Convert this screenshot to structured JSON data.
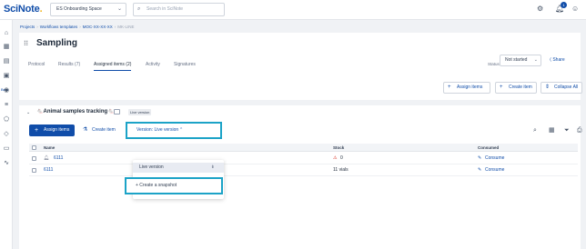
{
  "topbar": {
    "logo": "SciNote",
    "logo_dot": ".",
    "space": "ES Onboarding Space",
    "search_placeholder": "Search in SciNote",
    "notification_count": "1"
  },
  "sidebar": {
    "active_label": "Beta"
  },
  "breadcrumb": {
    "items": [
      "Projects",
      "Workflows templates",
      "MOC-XX-XX-XX"
    ],
    "current": "MK-LINE"
  },
  "page": {
    "title": "Sampling",
    "tabs": [
      "Protocol",
      "Results (7)",
      "Assigned items (2)",
      "Activity",
      "Signatures"
    ],
    "status_label": "Status",
    "status_value": "Not started",
    "share_label": "Share"
  },
  "toolbar": {
    "assign_items": "Assign items",
    "create_item": "Create item",
    "collapse_all": "Collapse All"
  },
  "repository": {
    "title": "Animal samples tracking",
    "emoji": "🐁",
    "badge": "Live version",
    "assign_items": "Assign items",
    "create_item": "Create item",
    "version_button": "Version: Live version"
  },
  "dropdown": {
    "live_version": "Live version",
    "create_snapshot": "+ Create a snapshot"
  },
  "table": {
    "headers": {
      "name": "Name",
      "stock": "Stock",
      "consumed": "Consumed"
    },
    "rows": [
      {
        "name": "6111",
        "stock": "0",
        "consumed": "Consume"
      },
      {
        "name": "6111",
        "stock": "11 vials",
        "consumed": "Consume"
      }
    ]
  },
  "colors": {
    "brand": "#104da9",
    "highlight": "#1ca3c7",
    "warning": "#d92d20"
  }
}
